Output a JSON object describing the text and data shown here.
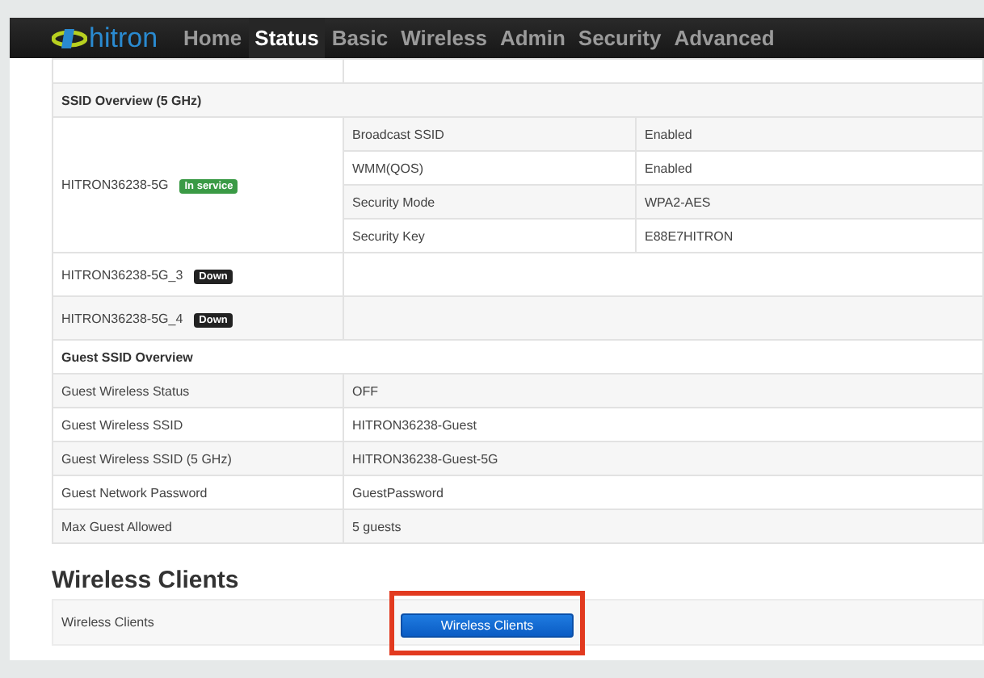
{
  "logo": "hitron",
  "nav": [
    {
      "label": "Home",
      "selected": false
    },
    {
      "label": "Status",
      "selected": true
    },
    {
      "label": "Basic",
      "selected": false
    },
    {
      "label": "Wireless",
      "selected": false
    },
    {
      "label": "Admin",
      "selected": false
    },
    {
      "label": "Security",
      "selected": false
    },
    {
      "label": "Advanced",
      "selected": false
    }
  ],
  "ssid_5g": {
    "title": "SSID Overview (5 GHz)",
    "networks": [
      {
        "name": "HITRON36238-5G",
        "status": "In service",
        "kind": "up",
        "details": [
          {
            "label": "Broadcast SSID",
            "value": "Enabled"
          },
          {
            "label": "WMM(QOS)",
            "value": "Enabled"
          },
          {
            "label": "Security Mode",
            "value": "WPA2-AES"
          },
          {
            "label": "Security Key",
            "value": "E88E7HITRON"
          }
        ]
      },
      {
        "name": "HITRON36238-5G_3",
        "status": "Down",
        "kind": "down"
      },
      {
        "name": "HITRON36238-5G_4",
        "status": "Down",
        "kind": "down"
      }
    ]
  },
  "guest": {
    "title": "Guest SSID Overview",
    "rows": [
      {
        "label": "Guest Wireless Status",
        "value": "OFF"
      },
      {
        "label": "Guest Wireless SSID",
        "value": "HITRON36238-Guest"
      },
      {
        "label": "Guest Wireless SSID (5 GHz)",
        "value": "HITRON36238-Guest-5G"
      },
      {
        "label": "Guest Network Password",
        "value": "GuestPassword"
      },
      {
        "label": "Max Guest Allowed",
        "value": "5 guests"
      }
    ]
  },
  "clients": {
    "heading": "Wireless Clients",
    "label": "Wireless Clients",
    "button": "Wireless Clients",
    "highlighted": true
  }
}
